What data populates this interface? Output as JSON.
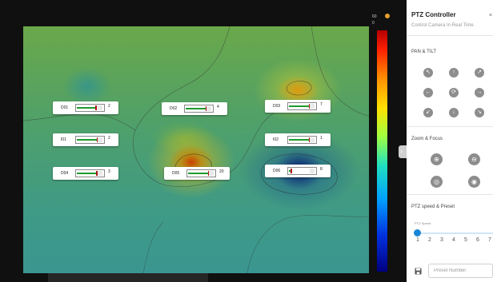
{
  "colors": {
    "accent": "#1a86d6",
    "gauge_fill": "#1e9a2e",
    "gauge_marker": "#b01515",
    "button_gray": "#8d8d8d"
  },
  "heatmap": {
    "colorbar": {
      "top_label": "60",
      "bottom_label": "0"
    },
    "sensors": [
      {
        "name": "D01",
        "value": "2",
        "level": 0.65
      },
      {
        "name": "I01",
        "value": "2",
        "level": 0.7
      },
      {
        "name": "D04",
        "value": "3",
        "level": 0.68
      },
      {
        "name": "D02",
        "value": "4",
        "level": 0.7
      },
      {
        "name": "D05",
        "value": "20",
        "level": 0.72
      },
      {
        "name": "D03",
        "value": "7",
        "level": 0.7
      },
      {
        "name": "I02",
        "value": "1",
        "level": 0.7
      },
      {
        "name": "D06",
        "value": "8",
        "level": 0.06
      }
    ]
  },
  "panel": {
    "title": "PTZ Controller",
    "subtitle": "Control Camera In Real Time",
    "close_icon": "×",
    "collapse_icon": "›",
    "pan_tilt": {
      "label": "PAN & TILT",
      "buttons": [
        {
          "icon": "↖"
        },
        {
          "icon": "↑"
        },
        {
          "icon": "↗"
        },
        {
          "icon": "←"
        },
        {
          "icon": "⟳"
        },
        {
          "icon": "→"
        },
        {
          "icon": "↙"
        },
        {
          "icon": "↓"
        },
        {
          "icon": "↘"
        }
      ]
    },
    "zoom_focus": {
      "label": "Zoom & Focus",
      "buttons": [
        {
          "icon": "⊕"
        },
        {
          "icon": "⊖"
        },
        {
          "icon": "◎"
        },
        {
          "icon": "◉"
        }
      ]
    },
    "speed": {
      "label": "PTZ speed & Preset",
      "slider_label": "PTZ Speed",
      "value": 1,
      "ticks": [
        "1",
        "2",
        "3",
        "4",
        "5",
        "6",
        "7"
      ]
    },
    "preset": {
      "placeholder": "Preset Number"
    }
  }
}
